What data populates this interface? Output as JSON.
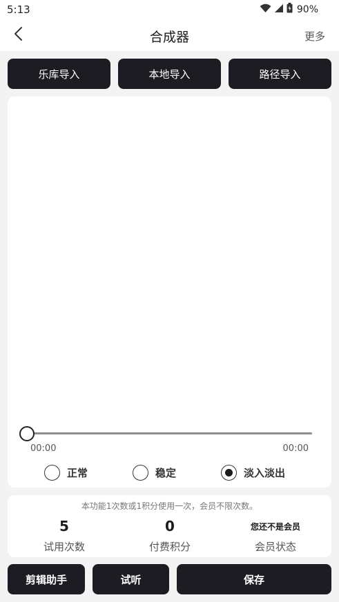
{
  "status_bar": {
    "time": "5:13",
    "battery_percent": "90%"
  },
  "header": {
    "title": "合成器",
    "more_label": "更多"
  },
  "import_buttons": [
    "乐库导入",
    "本地导入",
    "路径导入"
  ],
  "player": {
    "current_time": "00:00",
    "total_time": "00:00",
    "progress": 0
  },
  "modes": {
    "items": [
      "正常",
      "稳定",
      "淡入淡出"
    ],
    "selected": "淡入淡出"
  },
  "info": {
    "notice": "本功能1次数或1积分使用一次，会员不限次数。",
    "stats": [
      {
        "value": "5",
        "label": "试用次数"
      },
      {
        "value": "0",
        "label": "付费积分"
      },
      {
        "value": "您还不是会员",
        "label": "会员状态"
      }
    ]
  },
  "actions": {
    "editor_label": "剪辑助手",
    "preview_label": "试听",
    "save_label": "保存"
  },
  "colors": {
    "button_dark": "#1c1c22",
    "background": "#f3f3f3",
    "card": "#ffffff",
    "track": "#8c8c8c"
  },
  "icons": [
    "wifi-icon",
    "signal-icon",
    "battery-icon",
    "back-arrow-icon"
  ]
}
